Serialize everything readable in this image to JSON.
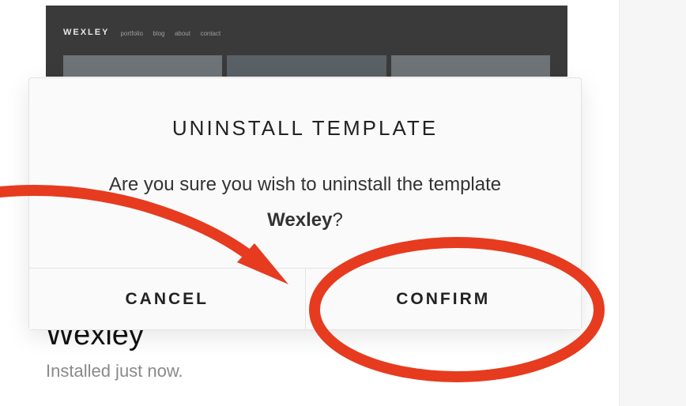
{
  "card": {
    "preview_logo": "WEXLEY",
    "preview_nav": [
      "portfolio",
      "blog",
      "about",
      "contact"
    ],
    "title": "Wexley",
    "status": "Installed just now."
  },
  "dialog": {
    "title": "UNINSTALL TEMPLATE",
    "message_prefix": "Are you sure you wish to uninstall the template ",
    "template_name": "Wexley",
    "message_suffix": "?",
    "cancel_label": "CANCEL",
    "confirm_label": "CONFIRM"
  },
  "annotation": {
    "arrow_color": "#e63b1f",
    "circle_color": "#e63b1f"
  }
}
